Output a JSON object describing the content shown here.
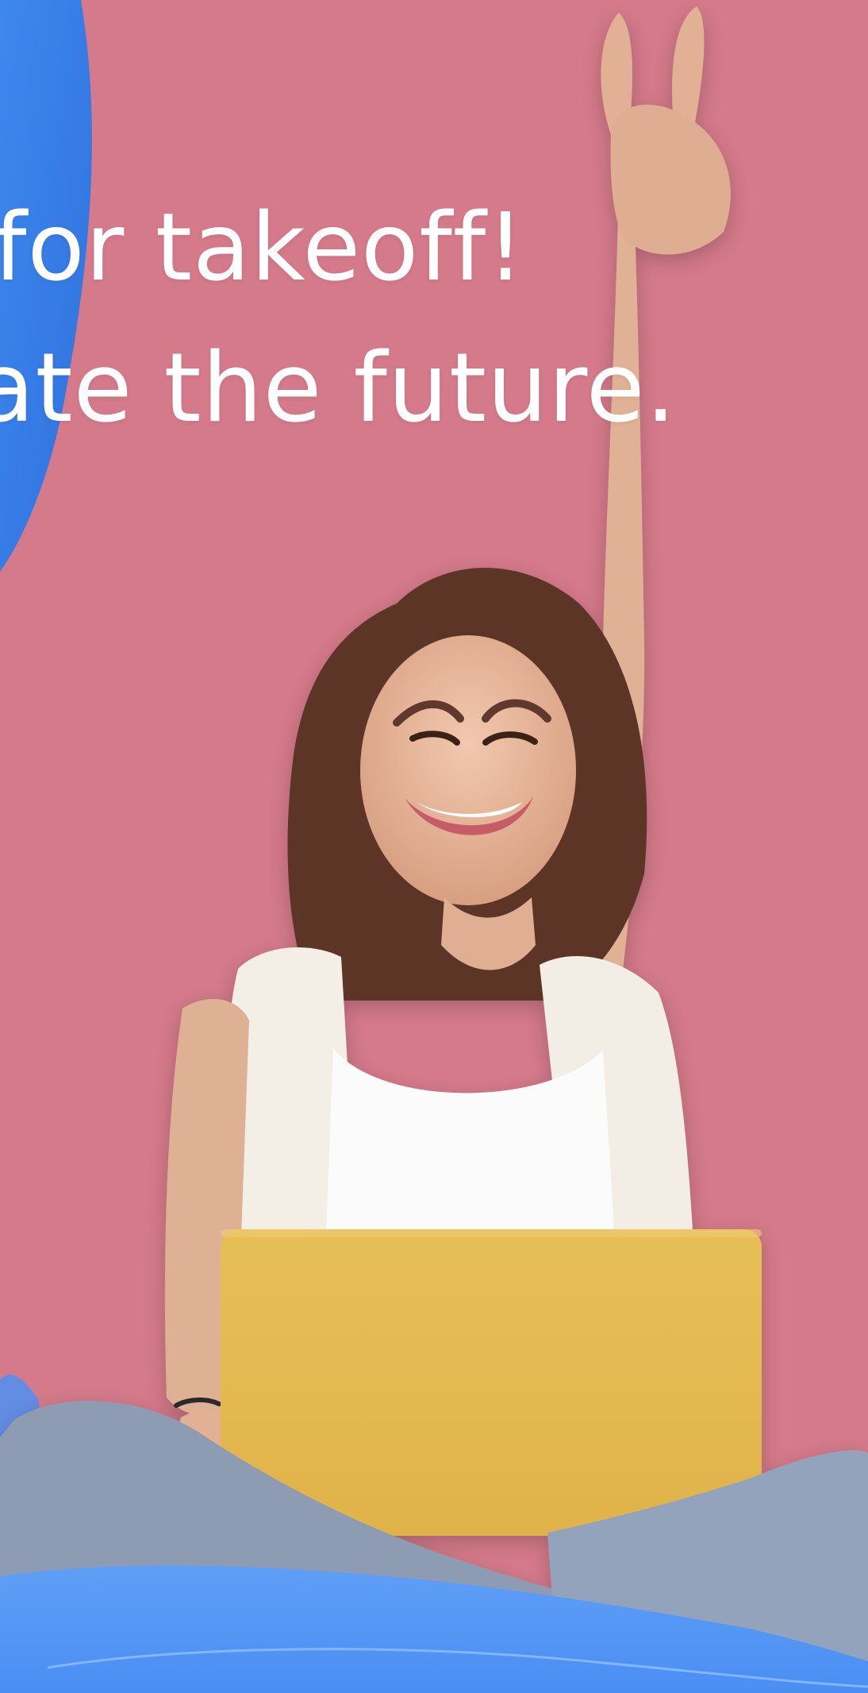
{
  "hero": {
    "headline_line_1": "for takeoff!",
    "headline_line_2": "ate the future."
  },
  "colors": {
    "background": "#d47a8a",
    "accent_blue": "#4d8df0",
    "laptop_yellow": "#e0b548",
    "skin": "#e3b49a",
    "hair": "#5a3525",
    "vest": "#f3efe7",
    "tank_top": "#fbfbfb",
    "jeans": "#8e9cb3"
  },
  "icons": {
    "person": "smiling-woman-with-laptop",
    "gesture": "peace-sign-hand"
  }
}
